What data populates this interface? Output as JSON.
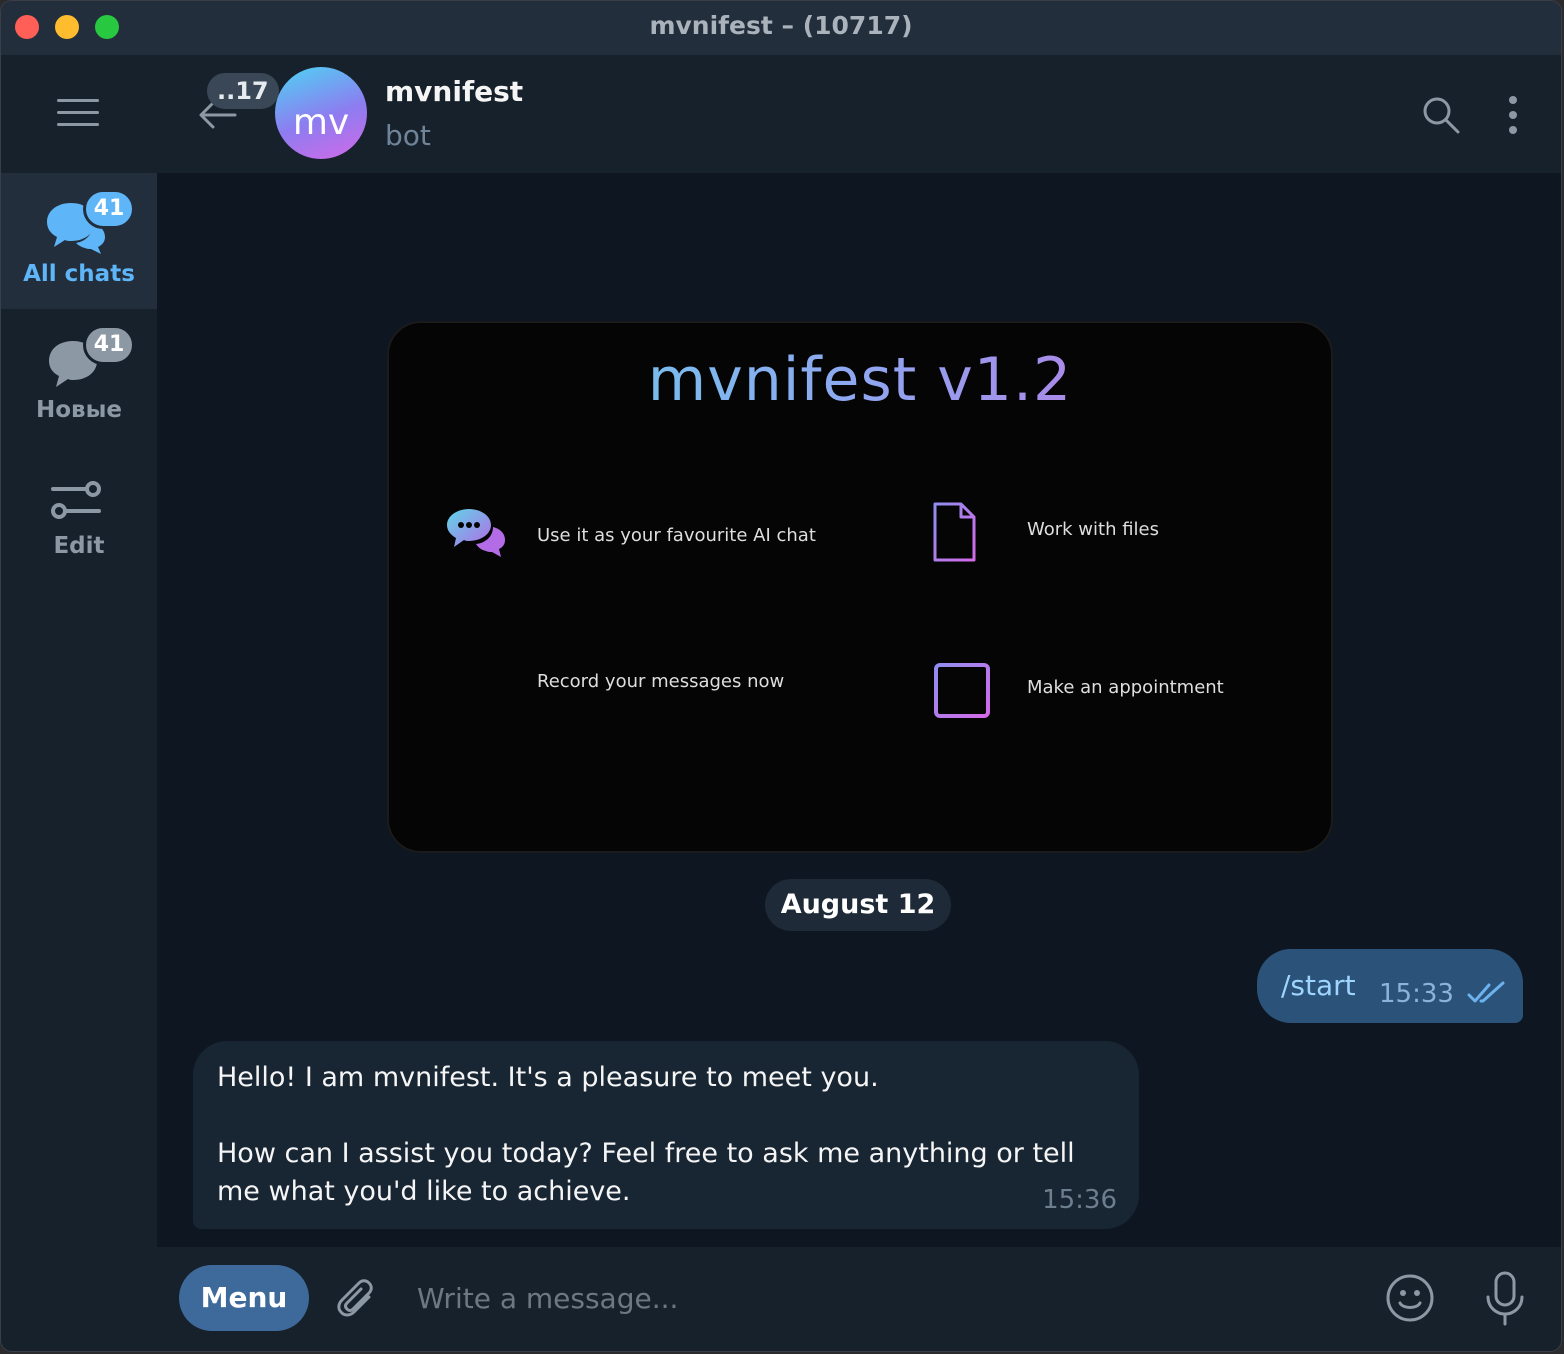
{
  "window": {
    "title": "mvnifest – (10717)"
  },
  "rail": {
    "folders": [
      {
        "label": "All chats",
        "badge": "41",
        "icon": "chats-icon",
        "active": true
      },
      {
        "label": "Новые",
        "badge": "41",
        "icon": "chat-bubble-icon",
        "active": false
      },
      {
        "label": "Edit",
        "icon": "sliders-icon",
        "active": false
      }
    ]
  },
  "header": {
    "back_badge": "..17",
    "avatar_initials": "mv",
    "name": "mvnifest",
    "status": "bot"
  },
  "banner": {
    "title": "mvnifest v1.2",
    "features": [
      {
        "text": "Use it as your favourite AI chat",
        "icon": "chat-bubbles-icon"
      },
      {
        "text": "Work with files",
        "icon": "document-icon"
      },
      {
        "text": "Record your messages now",
        "icon": "sound-wave-icon"
      },
      {
        "text": "Make an appointment",
        "icon": "calendar-icon"
      }
    ]
  },
  "messages": {
    "date": "August 12",
    "outgoing": {
      "text": "/start",
      "time": "15:33"
    },
    "incoming": {
      "text": "Hello! I am mvnifest. It's a pleasure to meet you.\n\nHow can I assist you today? Feel free to ask me anything or tell me what you'd like to achieve.",
      "time": "15:36"
    }
  },
  "composer": {
    "menu_label": "Menu",
    "placeholder": "Write a message..."
  },
  "colors": {
    "background": "#0e1621",
    "panel": "#17212b",
    "accent": "#5eb5f7",
    "outgoing_bubble": "#2b5278",
    "incoming_bubble": "#182533",
    "menu_button": "#3e6a9b"
  }
}
